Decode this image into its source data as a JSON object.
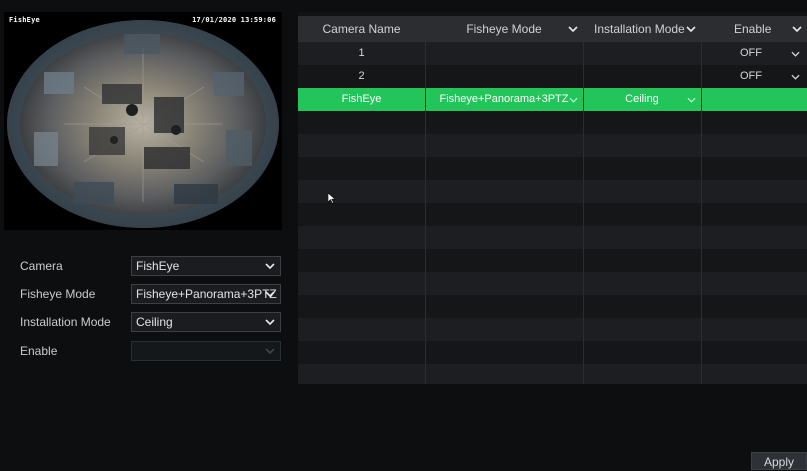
{
  "preview": {
    "osd_name": "FishEye",
    "osd_time": "17/01/2020 13:59:06"
  },
  "form": {
    "camera": {
      "label": "Camera",
      "value": "FishEye"
    },
    "fisheye_mode": {
      "label": "Fisheye Mode",
      "value": "Fisheye+Panorama+3PTZ"
    },
    "installation_mode": {
      "label": "Installation Mode",
      "value": "Ceiling"
    },
    "enable": {
      "label": "Enable",
      "value": ""
    }
  },
  "table": {
    "headers": [
      "Camera Name",
      "Fisheye Mode",
      "Installation Mode",
      "Enable"
    ],
    "rows": [
      {
        "name": "1",
        "mode": "",
        "install": "",
        "enable": "OFF"
      },
      {
        "name": "2",
        "mode": "",
        "install": "",
        "enable": "OFF"
      },
      {
        "name": "FishEye",
        "mode": "Fisheye+Panorama+3PTZ",
        "install": "Ceiling",
        "enable": ""
      }
    ],
    "selected_row": 2,
    "selected_color": "#21c55a"
  },
  "apply_label": "Apply"
}
